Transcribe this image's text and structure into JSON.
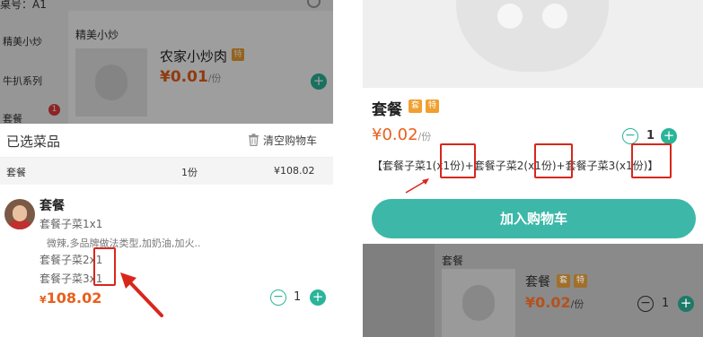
{
  "left": {
    "table_number": "桌号：A1",
    "categories": [
      "精美小炒",
      "牛扒系列",
      "套餐"
    ],
    "category_badge": "1",
    "section_title": "精美小炒",
    "dish": {
      "name": "农家小炒肉",
      "tag": "特",
      "price": "¥0.01",
      "unit": "/份"
    },
    "cart": {
      "title": "已选菜品",
      "clear_label": "清空购物车",
      "summary": {
        "name": "套餐",
        "count": "1份",
        "total": "¥108.02"
      },
      "item": {
        "name": "套餐",
        "sub_lines": [
          "套餐子菜1x1",
          "套餐子菜2x1",
          "套餐子菜3x1"
        ],
        "note": "微辣,多品牌做法类型,加奶油,加火..",
        "price": "108.02",
        "currency": "¥",
        "qty": "1"
      }
    }
  },
  "right": {
    "product": {
      "name": "套餐",
      "tags": [
        "套",
        "特"
      ],
      "price": "¥0.02",
      "unit": "/份",
      "qty": "1",
      "description": "【套餐子菜1(x1份)+套餐子菜2(x1份)+套餐子菜3(x1份)】",
      "add_to_cart_label": "加入购物车"
    },
    "background_list": {
      "section_title": "套餐",
      "dish": {
        "name": "套餐",
        "tags": [
          "套",
          "特"
        ],
        "price": "¥0.02",
        "unit": "/份",
        "qty": "1"
      }
    }
  },
  "colors": {
    "accent": "#2ab59a",
    "price": "#e8601c",
    "highlight": "#d9261c",
    "tag": "#f0a030"
  }
}
